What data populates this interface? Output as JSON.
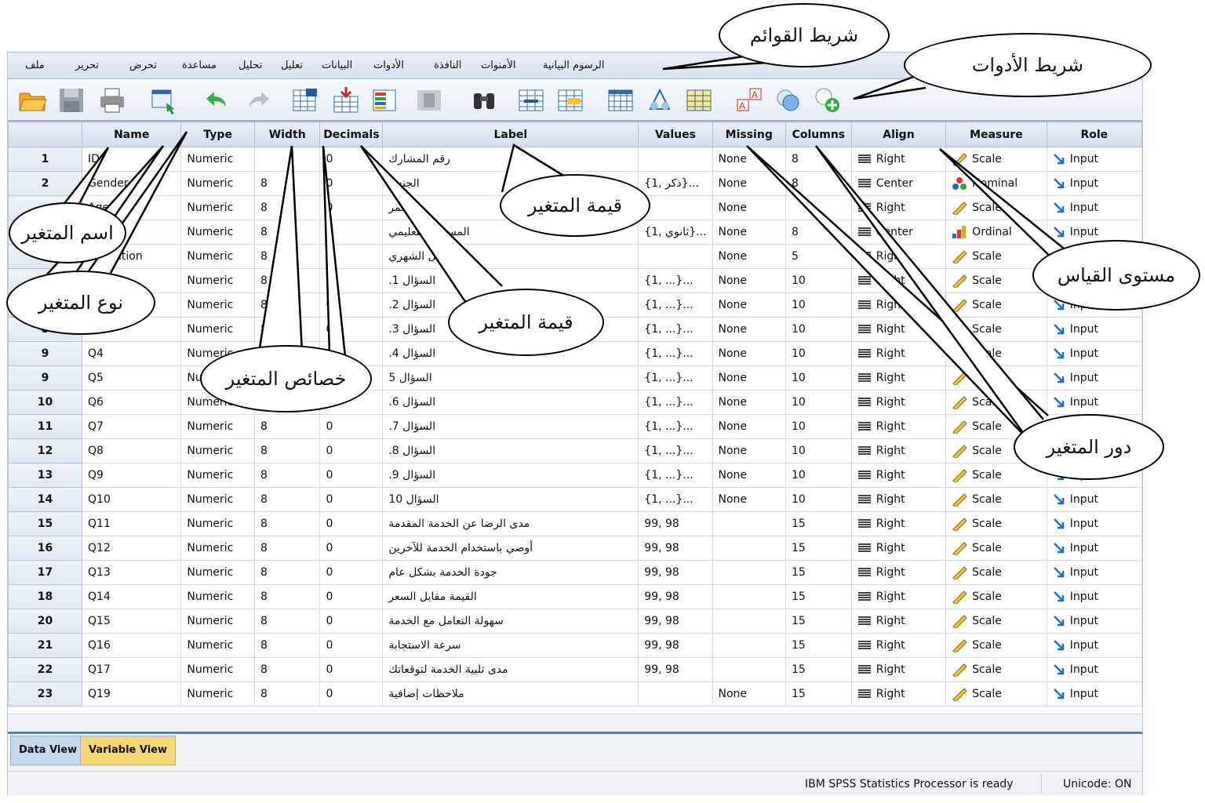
{
  "menu": [
    "ملف",
    "تحرير",
    "تحرض",
    "مساعدة",
    "تحليل",
    "تعليل",
    "البيانات",
    "الأدوات",
    "النافذة",
    "الأمنوات",
    "الرسوم البيانية"
  ],
  "columns": [
    "",
    "Name",
    "Type",
    "Width",
    "Decimals",
    "Label",
    "Values",
    "Missing",
    "Columns",
    "Align",
    "Measure",
    "Role"
  ],
  "rows": [
    {
      "n": "1",
      "name": "ID",
      "type": "Numeric",
      "width": "",
      "dec": "0",
      "label": "رقم المشارك",
      "values": "",
      "missing": "None",
      "cols": "8",
      "align": "Right",
      "measure": "Scale",
      "role": "Input"
    },
    {
      "n": "2",
      "name": "Gender",
      "type": "Numeric",
      "width": "8",
      "dec": "0",
      "label": "الجنس",
      "values": "{1, ذكر}...",
      "missing": "None",
      "cols": "8",
      "align": "Center",
      "measure": "Nominal",
      "role": "Input"
    },
    {
      "n": "",
      "name": "Age",
      "type": "Numeric",
      "width": "8",
      "dec": "0",
      "label": "العمر",
      "values": "",
      "missing": "None",
      "cols": "",
      "align": "Right",
      "measure": "Scale",
      "role": "Input"
    },
    {
      "n": "",
      "name": "",
      "type": "Numeric",
      "width": "8",
      "dec": "0",
      "label": "المستوى التعليمي",
      "values": "{1, ثانوي}...",
      "missing": "None",
      "cols": "8",
      "align": "Center",
      "measure": "Ordinal",
      "role": "Input"
    },
    {
      "n": "",
      "name": "Education",
      "type": "Numeric",
      "width": "8",
      "dec": "0",
      "label": "الدخل الشهري",
      "values": "",
      "missing": "None",
      "cols": "5",
      "align": "Right",
      "measure": "Scale",
      "role": "Input"
    },
    {
      "n": "",
      "name": "",
      "type": "Numeric",
      "width": "8",
      "dec": "0",
      "label": "السؤال 1.",
      "values": "{1, ...}...",
      "missing": "None",
      "cols": "10",
      "align": "Right",
      "measure": "Scale",
      "role": "Input"
    },
    {
      "n": "",
      "name": "",
      "type": "Numeric",
      "width": "8",
      "dec": "0",
      "label": "السؤال 2.",
      "values": "{1, ...}...",
      "missing": "None",
      "cols": "10",
      "align": "Right",
      "measure": "Scale",
      "role": "Input"
    },
    {
      "n": "8",
      "name": "Q3",
      "type": "Numeric",
      "width": "8",
      "dec": "0",
      "label": "السؤال 3.",
      "values": "{1, ...}...",
      "missing": "None",
      "cols": "10",
      "align": "Right",
      "measure": "Scale",
      "role": "Input"
    },
    {
      "n": "9",
      "name": "Q4",
      "type": "Numeric",
      "width": "8",
      "dec": "0",
      "label": "السؤال 4.",
      "values": "{1, ...}...",
      "missing": "None",
      "cols": "10",
      "align": "Right",
      "measure": "Scale",
      "role": "Input"
    },
    {
      "n": "9",
      "name": "Q5",
      "type": "Numeric",
      "width": "8",
      "dec": "0",
      "label": "السؤال 5",
      "values": "{1, ...}...",
      "missing": "None",
      "cols": "10",
      "align": "Right",
      "measure": "Scale",
      "role": "Input"
    },
    {
      "n": "10",
      "name": "Q6",
      "type": "Numeric",
      "width": "8",
      "dec": "0",
      "label": "السؤال 6.",
      "values": "{1, ...}...",
      "missing": "None",
      "cols": "10",
      "align": "Right",
      "measure": "Scale",
      "role": "Input"
    },
    {
      "n": "11",
      "name": "Q7",
      "type": "Numeric",
      "width": "8",
      "dec": "0",
      "label": "السؤال 7.",
      "values": "{1, ...}...",
      "missing": "None",
      "cols": "10",
      "align": "Right",
      "measure": "Scale",
      "role": "Input"
    },
    {
      "n": "12",
      "name": "Q8",
      "type": "Numeric",
      "width": "8",
      "dec": "0",
      "label": "السؤال 8.",
      "values": "{1, ...}...",
      "missing": "None",
      "cols": "10",
      "align": "Right",
      "measure": "Scale",
      "role": "Input"
    },
    {
      "n": "13",
      "name": "Q9",
      "type": "Numeric",
      "width": "8",
      "dec": "0",
      "label": "السؤال 9.",
      "values": "{1, ...}...",
      "missing": "None",
      "cols": "10",
      "align": "Right",
      "measure": "Scale",
      "role": "Input"
    },
    {
      "n": "14",
      "name": "Q10",
      "type": "Numeric",
      "width": "8",
      "dec": "0",
      "label": "السؤال 10",
      "values": "{1, ...}...",
      "missing": "None",
      "cols": "10",
      "align": "Right",
      "measure": "Scale",
      "role": "Input"
    },
    {
      "n": "15",
      "name": "Q11",
      "type": "Numeric",
      "width": "8",
      "dec": "0",
      "label": "مدى الرضا عن الخدمة المقدمة",
      "values": "99, 98",
      "missing": "",
      "cols": "15",
      "align": "Right",
      "measure": "Scale",
      "role": "Input"
    },
    {
      "n": "16",
      "name": "Q12",
      "type": "Numeric",
      "width": "8",
      "dec": "0",
      "label": "أوصي باستخدام الخدمة للآخرين",
      "values": "99, 98",
      "missing": "",
      "cols": "15",
      "align": "Right",
      "measure": "Scale",
      "role": "Input"
    },
    {
      "n": "17",
      "name": "Q13",
      "type": "Numeric",
      "width": "8",
      "dec": "0",
      "label": "جودة الخدمة بشكل عام",
      "values": "99, 98",
      "missing": "",
      "cols": "15",
      "align": "Right",
      "measure": "Scale",
      "role": "Input"
    },
    {
      "n": "18",
      "name": "Q14",
      "type": "Numeric",
      "width": "8",
      "dec": "0",
      "label": "القيمة مقابل السعر",
      "values": "99, 98",
      "missing": "",
      "cols": "15",
      "align": "Right",
      "measure": "Scale",
      "role": "Input"
    },
    {
      "n": "20",
      "name": "Q15",
      "type": "Numeric",
      "width": "8",
      "dec": "0",
      "label": "سهولة التعامل مع الخدمة",
      "values": "99, 98",
      "missing": "",
      "cols": "15",
      "align": "Right",
      "measure": "Scale",
      "role": "Input"
    },
    {
      "n": "21",
      "name": "Q16",
      "type": "Numeric",
      "width": "8",
      "dec": "0",
      "label": "سرعة الاستجابة",
      "values": "99, 98",
      "missing": "",
      "cols": "15",
      "align": "Right",
      "measure": "Scale",
      "role": "Input"
    },
    {
      "n": "22",
      "name": "Q17",
      "type": "Numeric",
      "width": "8",
      "dec": "0",
      "label": "مدى تلبية الخدمة لتوقعاتك",
      "values": "99, 98",
      "missing": "",
      "cols": "15",
      "align": "Right",
      "measure": "Scale",
      "role": "Input"
    },
    {
      "n": "23",
      "name": "Q19",
      "type": "Numeric",
      "width": "8",
      "dec": "0",
      "label": "ملاحظات إضافية",
      "values": "",
      "missing": "None",
      "cols": "15",
      "align": "Right",
      "measure": "Scale",
      "role": "Input"
    }
  ],
  "tabs": {
    "data_view": "Data View",
    "variable_view": "Variable View"
  },
  "status": {
    "processor": "IBM SPSS Statistics Processor is ready",
    "unicode": "Unicode: ON"
  },
  "callouts": {
    "menubar": "شريط القوائم",
    "toolbar": "شريط الأدوات",
    "var_name": "اسم المتغير",
    "var_type": "نوع المتغير",
    "var_props": "خصائص المتغير",
    "var_value_1": "قيمة المتغير",
    "var_value_2": "قيمة المتغير",
    "measure": "مستوى القياس",
    "role": "دور المتغير"
  },
  "colors": {
    "accent": "#4d7fb8",
    "active_tab": "#f7d774",
    "role_arrow": "#1a6fd1"
  }
}
